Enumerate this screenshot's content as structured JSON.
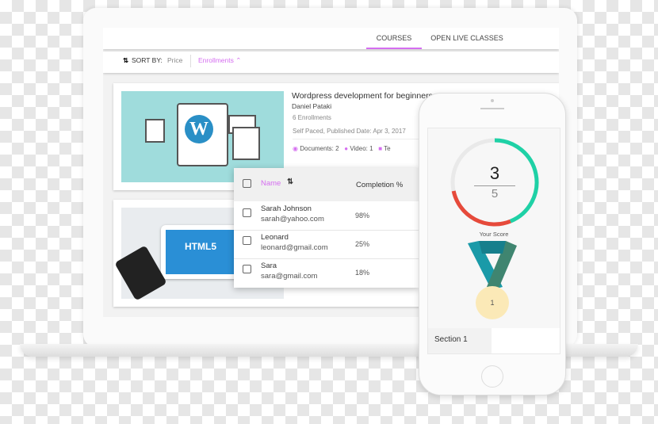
{
  "tabs": [
    {
      "label": "COURSES",
      "active": true
    },
    {
      "label": "OPEN LIVE CLASSES",
      "active": false
    }
  ],
  "sort": {
    "label": "SORT BY:",
    "options": [
      "Price",
      "Enrollments"
    ],
    "active": "Enrollments"
  },
  "course": {
    "title": "Wordpress development for beginners",
    "author": "Daniel Pataki",
    "enrollments": "6 Enrollments",
    "meta": "Self Paced, Published Date: Apr 3, 2017",
    "documents": "Documents: 2",
    "video": "Video: 1",
    "tests": "Te"
  },
  "course2": {
    "thumb_text": "HTML5"
  },
  "table": {
    "headers": {
      "name": "Name",
      "completion": "Completion %"
    },
    "rows": [
      {
        "name": "Sarah Johnson",
        "email": "sarah@yahoo.com",
        "completion": "98%"
      },
      {
        "name": "Leonard",
        "email": "leonard@gmail.com",
        "completion": "25%"
      },
      {
        "name": "Sara",
        "email": "sara@gmail.com",
        "completion": "18%"
      }
    ]
  },
  "score": {
    "value": "3",
    "total": "5",
    "label": "Your Score",
    "medal": "1"
  },
  "phone": {
    "section": "Section 1"
  },
  "colors": {
    "accent": "#d56ef0",
    "green": "#1fd1a6",
    "red": "#e64a3b",
    "teal": "#1a9aa8"
  }
}
